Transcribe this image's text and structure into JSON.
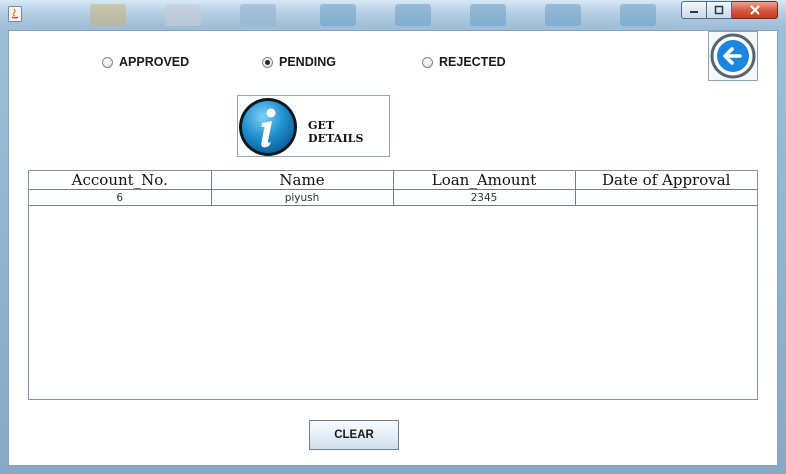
{
  "window": {
    "controls": [
      "minimize-icon",
      "maximize-icon",
      "close-icon"
    ]
  },
  "filters": [
    {
      "label": "APPROVED",
      "selected": false
    },
    {
      "label": "PENDING",
      "selected": true
    },
    {
      "label": "REJECTED",
      "selected": false
    }
  ],
  "actions": {
    "get_details_label": "GET DETAILS",
    "clear_label": "CLEAR",
    "back_icon": "back-arrow-icon",
    "info_icon": "info-icon"
  },
  "table": {
    "columns": [
      "Account_No.",
      "Name",
      "Loan_Amount",
      "Date of Approval"
    ],
    "rows": [
      [
        "6",
        "piyush",
        "2345",
        ""
      ]
    ]
  },
  "colors": {
    "back_icon_blue": "#1b86e0",
    "info_icon_blue": "#1f8fcf"
  }
}
